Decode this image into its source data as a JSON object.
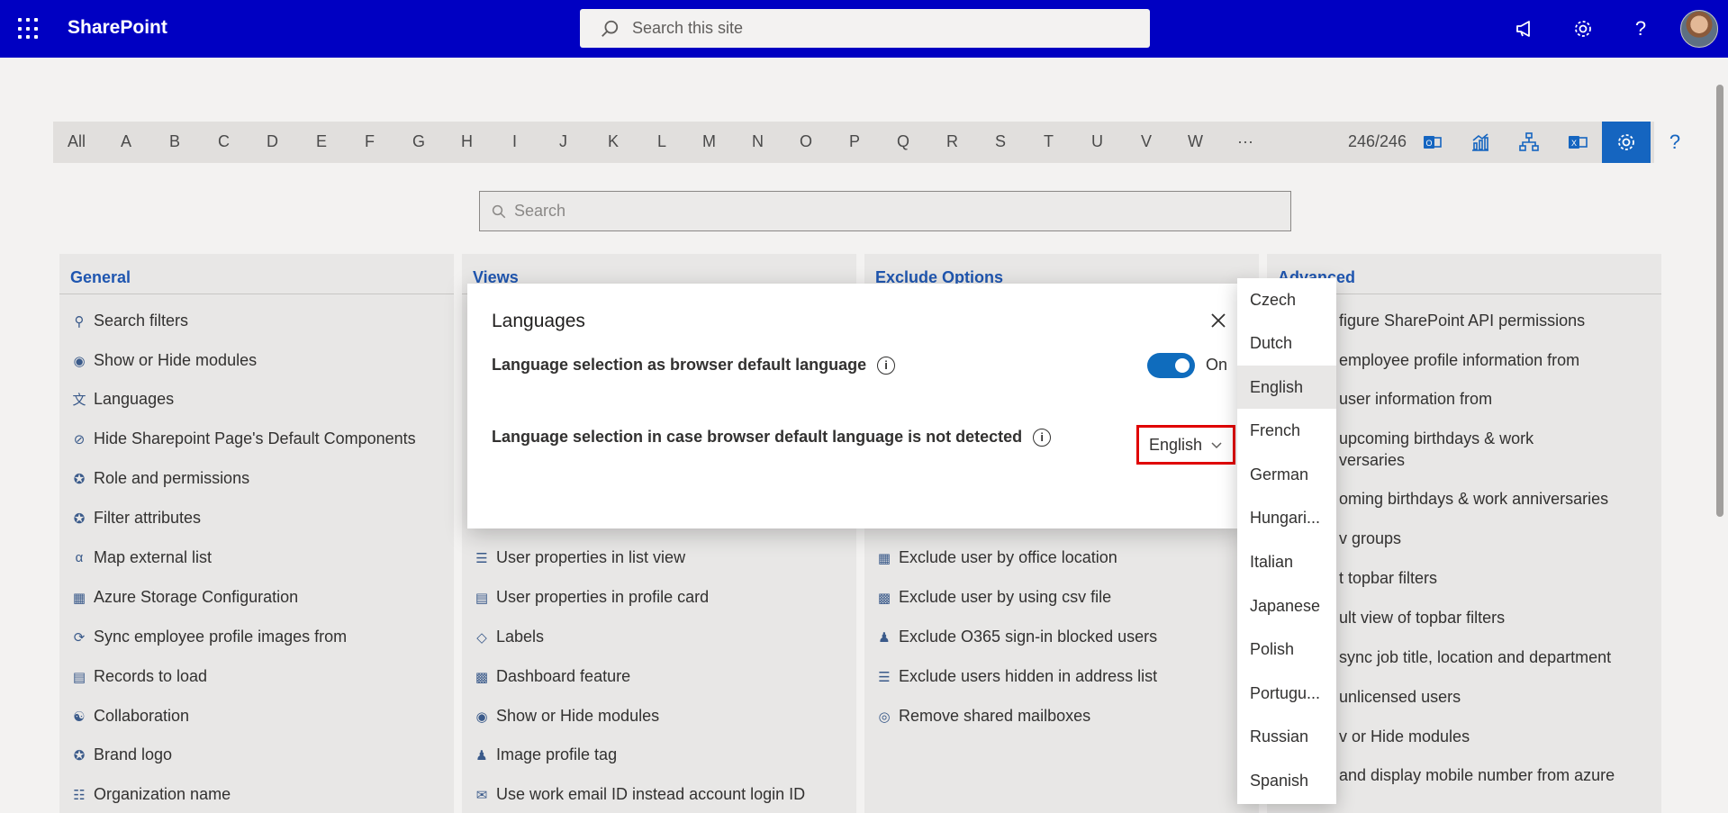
{
  "topbar": {
    "brand": "SharePoint",
    "search_placeholder": "Search this site"
  },
  "alphabar": {
    "letters": [
      "All",
      "A",
      "B",
      "C",
      "D",
      "E",
      "F",
      "G",
      "H",
      "I",
      "J",
      "K",
      "L",
      "M",
      "N",
      "O",
      "P",
      "Q",
      "R",
      "S",
      "T",
      "U",
      "V",
      "W"
    ],
    "more": "···",
    "count": "246/246"
  },
  "main_search": {
    "placeholder": "Search"
  },
  "columns": {
    "general": {
      "title": "General",
      "items": [
        "Search filters",
        "Show or Hide modules",
        "Languages",
        "Hide Sharepoint Page's Default Components",
        "Role and permissions",
        "Filter attributes",
        "Map external list",
        "Azure Storage Configuration",
        "Sync employee profile images from",
        "Records to load",
        "Collaboration",
        "Brand logo",
        "Organization name"
      ]
    },
    "views": {
      "title": "Views",
      "items": [
        "User properties in list view",
        "User properties in profile card",
        "Labels",
        "Dashboard feature",
        "Show or Hide modules",
        "Image profile tag",
        "Use work email ID instead account login ID"
      ]
    },
    "exclude": {
      "title": "Exclude Options",
      "items": [
        "Exclude user by office location",
        "Exclude user by using csv file",
        "Exclude O365 sign-in blocked users",
        "Exclude users hidden in address list",
        "Remove shared mailboxes"
      ]
    },
    "advanced": {
      "title": "Advanced",
      "items": [
        "figure SharePoint API permissions",
        "employee profile information from",
        "user information from",
        "upcoming birthdays & work",
        "versaries",
        "oming birthdays & work anniversaries",
        "v groups",
        "t topbar filters",
        "ult view of topbar filters",
        "sync job title, location and department",
        "unlicensed users",
        "v or Hide modules",
        "and display mobile number from azure"
      ]
    }
  },
  "modal": {
    "title": "Languages",
    "row1_label": "Language selection as browser default language",
    "toggle_state": "On",
    "row2_label": "Language selection in case browser default language is not detected",
    "selected_language": "English"
  },
  "dropdown": {
    "options": [
      "Czech",
      "Dutch",
      "English",
      "French",
      "German",
      "Hungari...",
      "Italian",
      "Japanese",
      "Polish",
      "Portugu...",
      "Russian",
      "Spanish"
    ],
    "selected": "English"
  },
  "colors": {
    "brand_bar": "#0000c2",
    "accent": "#1565c0",
    "highlight_border": "#e00000"
  }
}
